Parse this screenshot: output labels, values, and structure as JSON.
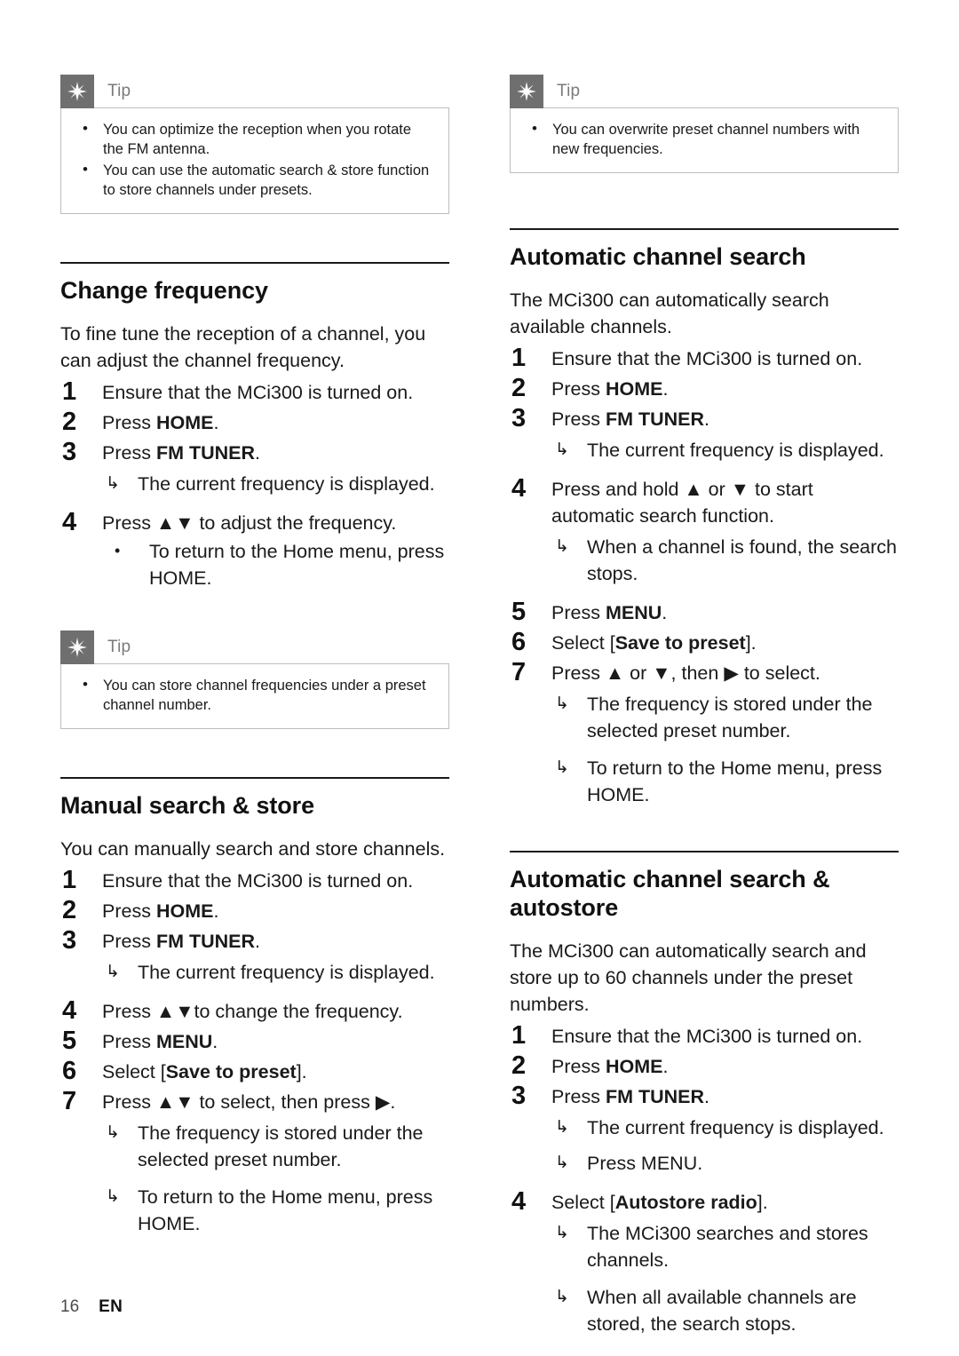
{
  "page": {
    "number": "16",
    "language": "EN"
  },
  "icons": {
    "tip": "tip-asterisk-icon",
    "result_arrow": "↳",
    "bullet": "•",
    "up_triangle": "▲",
    "down_triangle": "▼",
    "right_triangle": "▶"
  },
  "colors": {
    "tip_icon_bg": "#6f6f6f",
    "tip_title": "#7a7a7a",
    "tip_border": "#bdbdbd",
    "rule": "#1a1a1a",
    "text": "#1a1a1a"
  },
  "left_column": {
    "tip_top": {
      "title": "Tip",
      "items": [
        "You can optimize the reception when you rotate the FM antenna.",
        "You can use the automatic search & store function to store channels under presets."
      ]
    },
    "section_change_frequency": {
      "title": "Change frequency",
      "intro": "To fine tune the reception of a channel, you can adjust the channel frequency.",
      "steps": [
        {
          "num": "1",
          "text": "Ensure that the MCi300 is turned on."
        },
        {
          "num": "2",
          "text_pre": "Press ",
          "text_bold": "HOME",
          "text_post": "."
        },
        {
          "num": "3",
          "text_pre": "Press ",
          "text_bold": "FM TUNER",
          "text_post": ".",
          "results": [
            "The current frequency is displayed."
          ]
        },
        {
          "num": "4",
          "text": "Press ▲▼ to adjust the frequency.",
          "subs": [
            "To return to the Home menu, press HOME."
          ]
        }
      ]
    },
    "tip_middle": {
      "title": "Tip",
      "items": [
        "You can store channel frequencies under a preset channel number."
      ]
    },
    "section_manual_search": {
      "title": "Manual search & store",
      "intro": "You can manually search and store channels.",
      "steps": [
        {
          "num": "1",
          "text": "Ensure that the MCi300 is turned on."
        },
        {
          "num": "2",
          "text_pre": "Press ",
          "text_bold": "HOME",
          "text_post": "."
        },
        {
          "num": "3",
          "text_pre": "Press ",
          "text_bold": "FM TUNER",
          "text_post": ".",
          "results": [
            "The current frequency is displayed."
          ]
        },
        {
          "num": "4",
          "text": "Press ▲▼to change the frequency."
        },
        {
          "num": "5",
          "text_pre": "Press ",
          "text_bold": "MENU",
          "text_post": "."
        },
        {
          "num": "6",
          "text_pre": "Select [",
          "text_bold": "Save to preset",
          "text_post": "]."
        },
        {
          "num": "7",
          "text": "Press ▲▼ to select, then press ▶.",
          "results": [
            "The frequency is stored under the selected preset number.",
            "To return to the Home menu, press HOME."
          ]
        }
      ]
    }
  },
  "right_column": {
    "tip_top": {
      "title": "Tip",
      "items": [
        "You can overwrite preset channel numbers with new frequencies."
      ]
    },
    "section_automatic_search": {
      "title": "Automatic channel search",
      "intro": "The MCi300 can automatically search available channels.",
      "steps": [
        {
          "num": "1",
          "text": "Ensure that the MCi300 is turned on."
        },
        {
          "num": "2",
          "text_pre": "Press ",
          "text_bold": "HOME",
          "text_post": "."
        },
        {
          "num": "3",
          "text_pre": "Press ",
          "text_bold": "FM TUNER",
          "text_post": ".",
          "results": [
            "The current frequency is displayed."
          ]
        },
        {
          "num": "4",
          "text": "Press and hold ▲ or ▼ to start automatic search function.",
          "results": [
            "When a channel is found, the search stops."
          ]
        },
        {
          "num": "5",
          "text_pre": "Press ",
          "text_bold": "MENU",
          "text_post": "."
        },
        {
          "num": "6",
          "text_pre": "Select [",
          "text_bold": "Save to preset",
          "text_post": "]."
        },
        {
          "num": "7",
          "text": "Press ▲ or ▼, then ▶ to select.",
          "results": [
            "The frequency is stored under the selected preset number.",
            "To return to the Home menu, press HOME."
          ]
        }
      ]
    },
    "section_autostore": {
      "title": "Automatic channel search & autostore",
      "intro": "The MCi300 can automatically search and store up to 60 channels under the preset numbers.",
      "steps": [
        {
          "num": "1",
          "text": "Ensure that the MCi300 is turned on."
        },
        {
          "num": "2",
          "text_pre": "Press ",
          "text_bold": "HOME",
          "text_post": "."
        },
        {
          "num": "3",
          "text_pre": "Press ",
          "text_bold": "FM TUNER",
          "text_post": ".",
          "results": [
            "The current frequency is displayed.",
            "Press MENU."
          ]
        },
        {
          "num": "4",
          "text_pre": "Select [",
          "text_bold": "Autostore radio",
          "text_post": "].",
          "results": [
            "The MCi300 searches and stores channels.",
            "When all available channels are stored, the search stops."
          ]
        }
      ]
    }
  }
}
